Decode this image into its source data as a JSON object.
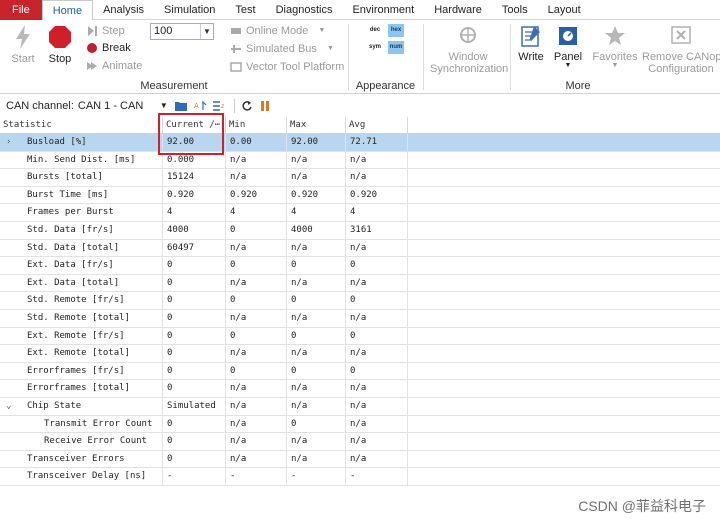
{
  "menu": {
    "tabs": [
      "File",
      "Home",
      "Analysis",
      "Simulation",
      "Test",
      "Diagnostics",
      "Environment",
      "Hardware",
      "Tools",
      "Layout"
    ],
    "active": "Home"
  },
  "ribbon": {
    "start": "Start",
    "stop": "Stop",
    "step": "Step",
    "break": "Break",
    "animate": "Animate",
    "combo_value": "100",
    "online_mode": "Online Mode",
    "simulated_bus": "Simulated Bus",
    "vector_tool_platform": "Vector Tool Platform",
    "measurement_label": "Measurement",
    "appearance": {
      "dec": "dec",
      "hex": "hex",
      "sym": "sym",
      "num": "num"
    },
    "appearance_label": "Appearance",
    "window_sync_line1": "Window",
    "window_sync_line2": "Synchronization",
    "write": "Write",
    "panel": "Panel",
    "favorites": "Favorites",
    "remove_canopen_line1": "Remove CANoper",
    "remove_canopen_line2": "Configuration",
    "more_label": "More"
  },
  "toolbar": {
    "channel_label": "CAN channel:",
    "channel_value": "CAN 1 - CAN"
  },
  "table": {
    "headers": {
      "stat": "Statistic",
      "current": "Current /⋯",
      "min": "Min",
      "max": "Max",
      "avg": "Avg"
    },
    "rows": [
      {
        "name": "Busload [%]",
        "cur": "92.00",
        "min": "0.00",
        "max": "92.00",
        "avg": "72.71"
      },
      {
        "name": "Min. Send Dist. [ms]",
        "cur": "0.000",
        "min": "n/a",
        "max": "n/a",
        "avg": "n/a"
      },
      {
        "name": "Bursts [total]",
        "cur": "15124",
        "min": "n/a",
        "max": "n/a",
        "avg": "n/a"
      },
      {
        "name": "Burst Time [ms]",
        "cur": "0.920",
        "min": "0.920",
        "max": "0.920",
        "avg": "0.920"
      },
      {
        "name": "Frames per Burst",
        "cur": "4",
        "min": "4",
        "max": "4",
        "avg": "4"
      },
      {
        "name": "Std. Data [fr/s]",
        "cur": "4000",
        "min": "0",
        "max": "4000",
        "avg": "3161"
      },
      {
        "name": "Std. Data [total]",
        "cur": "60497",
        "min": "n/a",
        "max": "n/a",
        "avg": "n/a"
      },
      {
        "name": "Ext. Data [fr/s]",
        "cur": "0",
        "min": "0",
        "max": "0",
        "avg": "0"
      },
      {
        "name": "Ext. Data [total]",
        "cur": "0",
        "min": "n/a",
        "max": "n/a",
        "avg": "n/a"
      },
      {
        "name": "Std. Remote [fr/s]",
        "cur": "0",
        "min": "0",
        "max": "0",
        "avg": "0"
      },
      {
        "name": "Std. Remote [total]",
        "cur": "0",
        "min": "n/a",
        "max": "n/a",
        "avg": "n/a"
      },
      {
        "name": "Ext. Remote [fr/s]",
        "cur": "0",
        "min": "0",
        "max": "0",
        "avg": "0"
      },
      {
        "name": "Ext. Remote [total]",
        "cur": "0",
        "min": "n/a",
        "max": "n/a",
        "avg": "n/a"
      },
      {
        "name": "Errorframes [fr/s]",
        "cur": "0",
        "min": "0",
        "max": "0",
        "avg": "0"
      },
      {
        "name": "Errorframes [total]",
        "cur": "0",
        "min": "n/a",
        "max": "n/a",
        "avg": "n/a"
      },
      {
        "name": "Chip State",
        "cur": "Simulated",
        "min": "n/a",
        "max": "n/a",
        "avg": "n/a"
      },
      {
        "name": "Transmit Error Count",
        "cur": "0",
        "min": "n/a",
        "max": "0",
        "avg": "n/a"
      },
      {
        "name": "Receive Error Count",
        "cur": "0",
        "min": "n/a",
        "max": "n/a",
        "avg": "n/a"
      },
      {
        "name": "Transceiver Errors",
        "cur": "0",
        "min": "n/a",
        "max": "n/a",
        "avg": "n/a"
      },
      {
        "name": "Transceiver Delay [ns]",
        "cur": "-",
        "min": "-",
        "max": "-",
        "avg": "-"
      }
    ]
  },
  "watermark": "CSDN @菲益科电子",
  "colors": {
    "file_tab": "#c8242c",
    "selected_row": "#b9d6f0",
    "highlight_box": "#d4202a"
  }
}
